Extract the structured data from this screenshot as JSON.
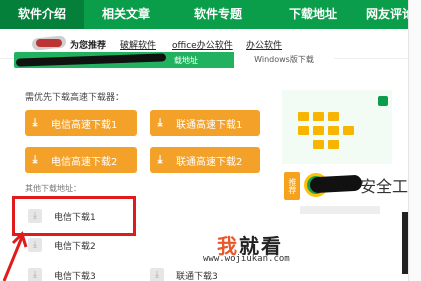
{
  "topnav": {
    "tabs": [
      "软件介绍",
      "相关文章",
      "软件专题",
      "下载地址",
      "网友评论"
    ]
  },
  "subnav": {
    "recommend": "为您推荐",
    "links": [
      "破解软件",
      "office办公软件",
      "办公软件"
    ]
  },
  "download_tabs": {
    "web_tab": "载地址",
    "win_tab": "Windows版下载"
  },
  "download": {
    "section_label": "需优先下载高速下载器：",
    "high_speed": [
      {
        "label": "电信高速下载1"
      },
      {
        "label": "联通高速下载1"
      },
      {
        "label": "电信高速下载2"
      },
      {
        "label": "联通高速下载2"
      }
    ],
    "other_label": "其他下载地址：",
    "plain": [
      {
        "label": "电信下载1"
      },
      {
        "label": "电信下载2"
      },
      {
        "label": "电信下载3"
      },
      {
        "label": "联通下载3"
      }
    ]
  },
  "ad": {
    "badge": "推荐",
    "brand_tail": "安全工"
  },
  "watermark": {
    "logo_part1": "我",
    "logo_part2": "就看",
    "url": "www.wojiukan.com"
  },
  "colors": {
    "nav_green": "#0b9e4a",
    "button_orange": "#f4a12a",
    "highlight_red": "#e01b1b"
  },
  "icons": {
    "download": "download-arrow-icon"
  }
}
